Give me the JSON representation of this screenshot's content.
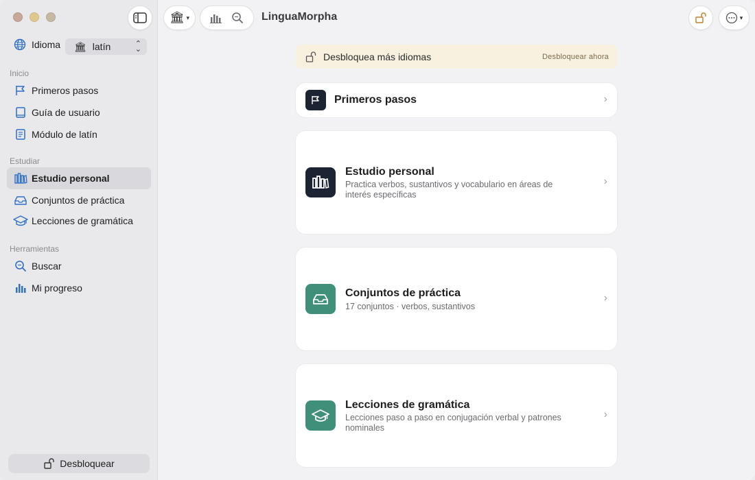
{
  "app": {
    "title": "LinguaMorpha"
  },
  "sidebar": {
    "language_label": "Idioma",
    "language_value": "latín",
    "sections": [
      {
        "title": "Inicio",
        "items": [
          {
            "label": "Primeros pasos",
            "icon": "flag-icon"
          },
          {
            "label": "Guía de usuario",
            "icon": "book-icon"
          },
          {
            "label": "Módulo de latín",
            "icon": "document-icon"
          }
        ]
      },
      {
        "title": "Estudiar",
        "items": [
          {
            "label": "Estudio personal",
            "icon": "books-icon",
            "active": true
          },
          {
            "label": "Conjuntos de práctica",
            "icon": "tray-icon"
          },
          {
            "label": "Lecciones de gramática",
            "icon": "graduation-cap-icon"
          }
        ]
      },
      {
        "title": "Herramientas",
        "items": [
          {
            "label": "Buscar",
            "icon": "search-icon"
          },
          {
            "label": "Mi progreso",
            "icon": "bar-chart-icon"
          }
        ]
      }
    ],
    "unlock_label": "Desbloquear"
  },
  "banner": {
    "text": "Desbloquea más idiomas",
    "link": "Desbloquear ahora"
  },
  "cards": [
    {
      "title": "Primeros pasos",
      "subtitle": "",
      "icon": "flag-icon"
    },
    {
      "title": "Estudio personal",
      "subtitle": "Practica verbos, sustantivos y vocabulario en áreas de interés específicas",
      "icon": "books-icon"
    },
    {
      "title": "Conjuntos de práctica",
      "subtitle": "17 conjuntos · verbos, sustantivos",
      "icon": "tray-icon"
    },
    {
      "title": "Lecciones de gramática",
      "subtitle": "Lecciones paso a paso en conjugación verbal y patrones nominales",
      "icon": "graduation-cap-icon"
    }
  ],
  "colors": {
    "accent_blue": "#2f6fc6",
    "badge_navy": "#1c2433",
    "badge_green": "#3f8f7a",
    "banner_bg": "#f8f1df"
  }
}
